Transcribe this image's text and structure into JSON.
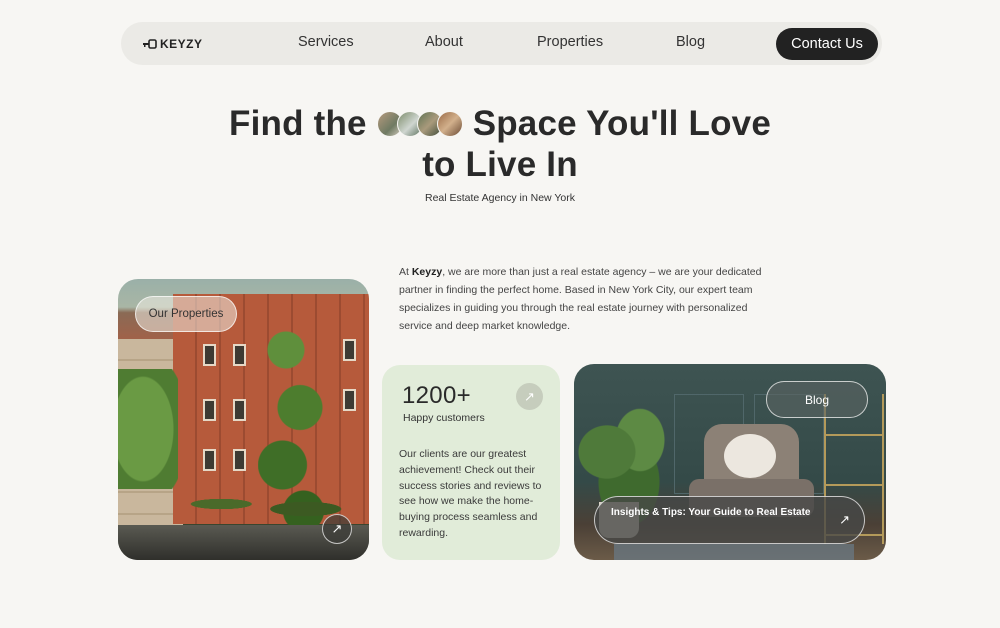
{
  "nav": {
    "logo": "KEYZY",
    "links": [
      "Services",
      "About",
      "Properties",
      "Blog"
    ],
    "contact": "Contact Us"
  },
  "hero": {
    "title_part1": "Find the",
    "title_part2": "Space You'll Love",
    "title_line2": "to Live In",
    "subtitle": "Real Estate Agency in New York"
  },
  "about": {
    "brand": "Keyzy",
    "prefix": "At ",
    "text": ", we are more than just a real estate agency – we are your dedicated partner in finding the perfect home. Based in New York City, our expert team specializes in guiding you through the real estate journey with personalized service and deep market knowledge."
  },
  "properties_card": {
    "label": "Our Properties",
    "arrow_icon": "arrow-up-right-icon"
  },
  "stats_card": {
    "number": "1200+",
    "label": "Happy customers",
    "description": "Our clients are our greatest achievement! Check out their success stories and reviews to see how we make the home-buying process seamless and rewarding.",
    "background": "#e1ecd9"
  },
  "blog_card": {
    "label": "Blog",
    "banner": "Insights & Tips: Your Guide to Real Estate"
  },
  "colors": {
    "background": "#f7f6f3",
    "nav_bg": "#ebeae6",
    "dark": "#222222"
  }
}
